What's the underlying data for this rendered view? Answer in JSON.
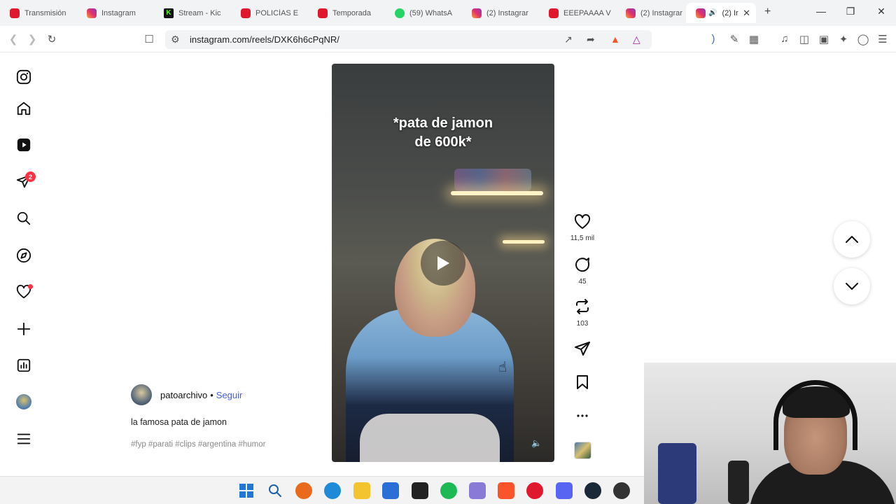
{
  "tabs": [
    {
      "label": "Transmisión",
      "icon": "youtube-icon",
      "kind": "yt"
    },
    {
      "label": "Instagram",
      "icon": "instagram-icon",
      "kind": "ig"
    },
    {
      "label": "Stream - Kic",
      "icon": "kick-icon",
      "kind": "kick"
    },
    {
      "label": "POLICÍAS E",
      "icon": "youtube-icon",
      "kind": "yt"
    },
    {
      "label": "Temporada",
      "icon": "youtube-icon",
      "kind": "yt"
    },
    {
      "label": "(59) WhatsA",
      "icon": "whatsapp-icon",
      "kind": "wa"
    },
    {
      "label": "(2) Instagrar",
      "icon": "instagram-icon",
      "kind": "ig"
    },
    {
      "label": "EEEPAAAA V",
      "icon": "youtube-icon",
      "kind": "yt"
    },
    {
      "label": "(2) Instagrar",
      "icon": "instagram-icon",
      "kind": "ig"
    },
    {
      "label": "(2) Ir",
      "icon": "instagram-icon",
      "kind": "ig",
      "active": true
    }
  ],
  "browser": {
    "url": "instagram.com/reels/DXK6h6cPqNR/"
  },
  "sidebar": {
    "notification_badge": "2"
  },
  "reel": {
    "caption_overlay": "*pata de jamon\nde 600k*",
    "likes": "11,5 mil",
    "comments": "45",
    "reposts": "103",
    "username": "patoarchivo",
    "separator": "•",
    "follow_label": "Seguir",
    "caption": "la famosa pata de jamon",
    "hashtags": "#fyp #parati #clips #argentina #humor"
  },
  "colors": {
    "accent_blue": "#4a5de8",
    "badge_red": "#ff3040"
  }
}
